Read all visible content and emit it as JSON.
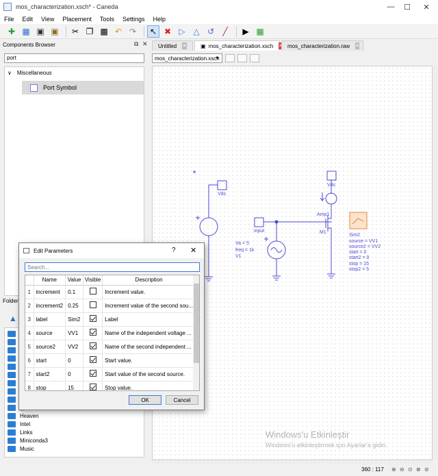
{
  "window": {
    "title": "mos_characterization.xsch* - Caneda"
  },
  "menu": [
    "File",
    "Edit",
    "View",
    "Placement",
    "Tools",
    "Settings",
    "Help"
  ],
  "components_browser": {
    "title": "Components Browser",
    "search_value": "port",
    "category": "Miscellaneous",
    "item": "Port Symbol"
  },
  "folder_browser": {
    "title": "Folder",
    "items": [
      "gprMax",
      "Heaven",
      "Intel",
      "Links",
      "Miniconda3",
      "Music"
    ]
  },
  "tabs": [
    {
      "label": "Untitled"
    },
    {
      "label": "mos_characterization.xsch"
    },
    {
      "label": "mos_characterization.raw"
    }
  ],
  "file_combo": "mos_characterization.xsch",
  "schematic": {
    "port_vds_left": "Vds",
    "port_vds_right": "Vds",
    "port_input": "input",
    "source": {
      "va": "Va = 5",
      "freq": "freq = 1k",
      "name": "V1"
    },
    "ammeter": "Amp1",
    "mos": "M1",
    "sim": {
      "name": "Sim2",
      "lines": [
        "source = VV1",
        "source2 = VV2",
        "start = 0",
        "start2 = 0",
        "stop = 15",
        "stop2 = 5"
      ]
    }
  },
  "dialog": {
    "title": "Edit Parameters",
    "help": "?",
    "search_placeholder": "Search...",
    "columns": [
      "Name",
      "Value",
      "Visible",
      "Description"
    ],
    "rows": [
      {
        "n": "1",
        "name": "increment",
        "value": "0.1",
        "visible": false,
        "desc": "Increment value."
      },
      {
        "n": "2",
        "name": "increment2",
        "value": "0.25",
        "visible": false,
        "desc": "Increment value of the second sou..."
      },
      {
        "n": "3",
        "name": "label",
        "value": "Sim2",
        "visible": true,
        "desc": "Label"
      },
      {
        "n": "4",
        "name": "source",
        "value": "VV1",
        "visible": true,
        "desc": "Name of the independent voltage ..."
      },
      {
        "n": "5",
        "name": "source2",
        "value": "VV2",
        "visible": true,
        "desc": "Name of the second independent ..."
      },
      {
        "n": "6",
        "name": "start",
        "value": "0",
        "visible": true,
        "desc": "Start value."
      },
      {
        "n": "7",
        "name": "start2",
        "value": "0",
        "visible": true,
        "desc": "Start value of the second source."
      },
      {
        "n": "8",
        "name": "stop",
        "value": "15",
        "visible": true,
        "desc": "Stop value."
      }
    ],
    "ok": "OK",
    "cancel": "Cancel"
  },
  "status": {
    "coords": "360 : 117"
  },
  "watermark": {
    "line1": "Windows'u Etkinleştir",
    "line2": "Windows'u etkinleştirmek için Ayarlar'a gidin."
  }
}
